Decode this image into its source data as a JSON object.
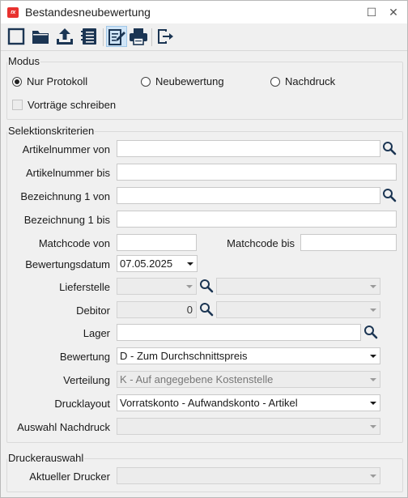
{
  "window": {
    "title": "Bestandesneubewertung",
    "logo_text": "rx"
  },
  "window_controls": {
    "maximize": "☐",
    "close": "✕"
  },
  "toolbar": {
    "icons": [
      "new-document-icon",
      "open-folder-icon",
      "upload-icon",
      "list-icon",
      "edit-icon",
      "print-icon",
      "exit-icon"
    ]
  },
  "modus": {
    "legend": "Modus",
    "options": [
      {
        "label": "Nur Protokoll",
        "selected": true
      },
      {
        "label": "Neubewertung",
        "selected": false
      },
      {
        "label": "Nachdruck",
        "selected": false
      }
    ],
    "vortraege_label": "Vorträge schreiben",
    "vortraege_checked": false
  },
  "selektion": {
    "legend": "Selektionskriterien",
    "artikelnummer_von": {
      "label": "Artikelnummer von",
      "value": ""
    },
    "artikelnummer_bis": {
      "label": "Artikelnummer bis",
      "value": ""
    },
    "bezeichnung_von": {
      "label": "Bezeichnung 1 von",
      "value": ""
    },
    "bezeichnung_bis": {
      "label": "Bezeichnung 1 bis",
      "value": ""
    },
    "matchcode_von": {
      "label": "Matchcode von",
      "value": ""
    },
    "matchcode_bis": {
      "label": "Matchcode bis",
      "value": ""
    },
    "bewertungsdatum": {
      "label": "Bewertungsdatum",
      "value": "07.05.2025"
    },
    "lieferstelle": {
      "label": "Lieferstelle",
      "value": "",
      "name_value": ""
    },
    "debitor": {
      "label": "Debitor",
      "value": "0",
      "name_value": ""
    },
    "lager": {
      "label": "Lager",
      "value": ""
    },
    "bewertung": {
      "label": "Bewertung",
      "value": "D - Zum Durchschnittspreis"
    },
    "verteilung": {
      "label": "Verteilung",
      "value": "K - Auf angegebene Kostenstelle"
    },
    "drucklayout": {
      "label": "Drucklayout",
      "value": "Vorratskonto - Aufwandskonto - Artikel"
    },
    "auswahl_nachdruck": {
      "label": "Auswahl Nachdruck",
      "value": ""
    }
  },
  "drucker": {
    "legend": "Druckerauswahl",
    "aktueller_drucker": {
      "label": "Aktueller Drucker",
      "value": ""
    }
  },
  "colors": {
    "accent_active": "#cfe4f6",
    "toolbar_icon": "#1b3553",
    "logo": "#e8322f"
  }
}
